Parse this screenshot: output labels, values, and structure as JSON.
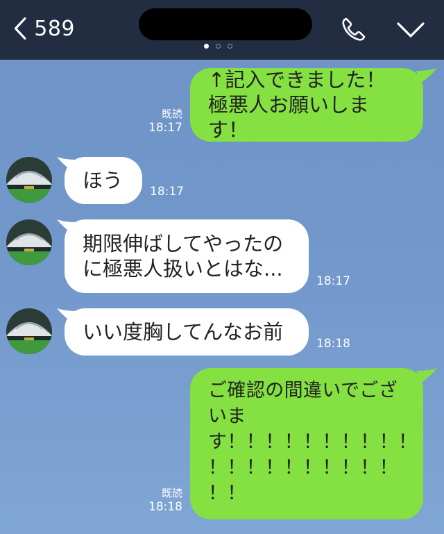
{
  "header": {
    "unread_count": "589",
    "icons": {
      "back": "chevron-left-icon",
      "call": "phone-icon",
      "menu": "chevron-down-icon"
    }
  },
  "colors": {
    "header_bg": "#232d42",
    "chat_bg": "#7197cb",
    "outgoing_bubble": "#84e141",
    "incoming_bubble": "#ffffff"
  },
  "messages": [
    {
      "direction": "out",
      "lines": [
        "↑記入できました！",
        "極悪人お願いします！"
      ],
      "read": "既読",
      "time": "18:17"
    },
    {
      "direction": "in",
      "lines": [
        "ほう"
      ],
      "time": "18:17"
    },
    {
      "direction": "in",
      "lines": [
        "期限伸ばしてやったの",
        "に極悪人扱いとはな..."
      ],
      "time": "18:17"
    },
    {
      "direction": "in",
      "lines": [
        "いい度胸してんなお前"
      ],
      "time": "18:18"
    },
    {
      "direction": "out",
      "lines": [
        "ご確認の間違いでござ",
        "いま",
        "す！！！！！！！！！！",
        "！！！！！！！！！！",
        "！！"
      ],
      "read": "既読",
      "time": "18:18"
    }
  ]
}
